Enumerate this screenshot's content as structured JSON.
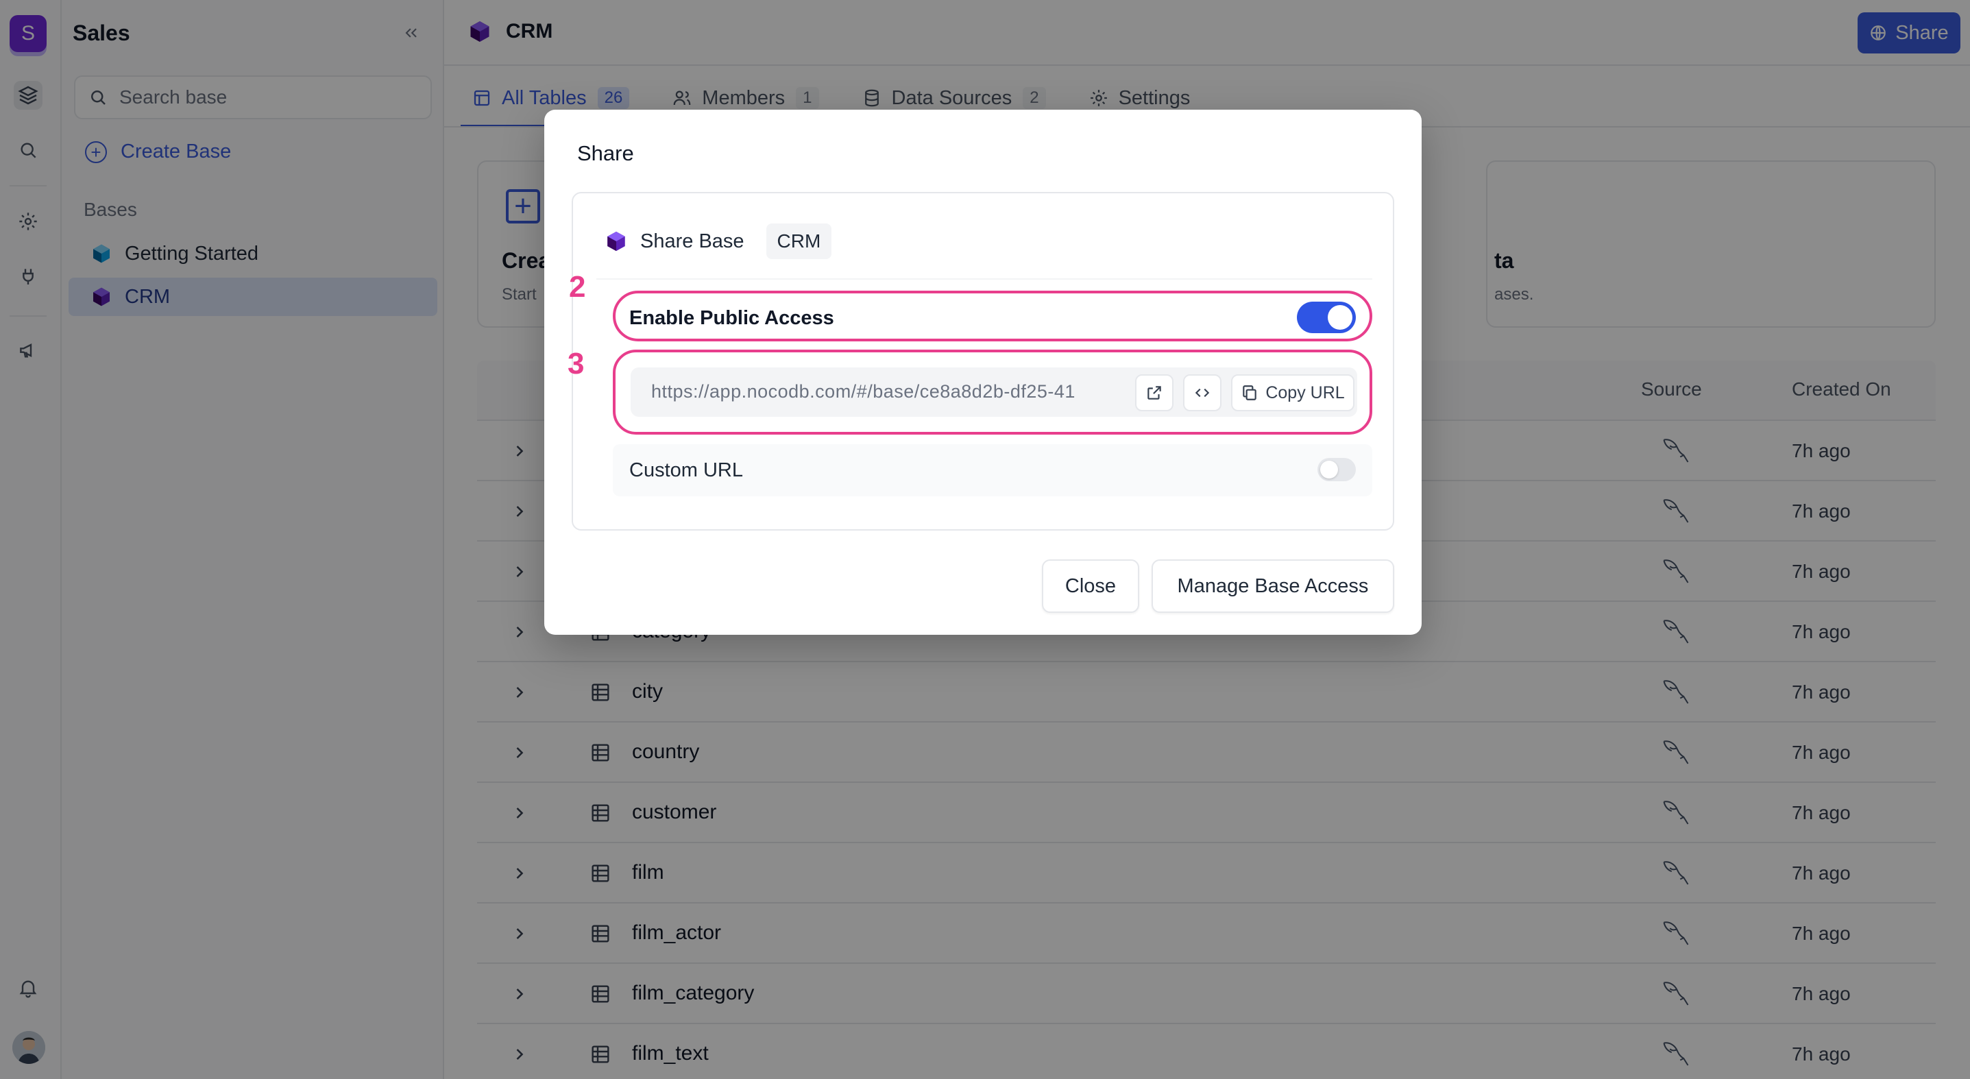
{
  "workspace": {
    "initial": "S"
  },
  "sidebar": {
    "title": "Sales",
    "search_placeholder": "Search base",
    "create_label": "Create Base",
    "section_label": "Bases",
    "bases": [
      {
        "label": "Getting Started",
        "color": "#0ea5e9"
      },
      {
        "label": "CRM",
        "color": "#5b21b6"
      }
    ]
  },
  "header": {
    "breadcrumb": "CRM",
    "share_label": "Share"
  },
  "tabs": [
    {
      "label": "All Tables",
      "count": "26"
    },
    {
      "label": "Members",
      "count": "1"
    },
    {
      "label": "Data Sources",
      "count": "2"
    },
    {
      "label": "Settings"
    }
  ],
  "cards": {
    "create_title": "Crea",
    "create_sub": "Start",
    "right_title": "ta",
    "right_sub": "ases."
  },
  "table": {
    "columns": {
      "source": "Source",
      "created": "Created On"
    },
    "rows": [
      {
        "name": "",
        "created": "7h ago"
      },
      {
        "name": "",
        "created": "7h ago"
      },
      {
        "name": "",
        "created": "7h ago"
      },
      {
        "name": "category",
        "created": "7h ago"
      },
      {
        "name": "city",
        "created": "7h ago"
      },
      {
        "name": "country",
        "created": "7h ago"
      },
      {
        "name": "customer",
        "created": "7h ago"
      },
      {
        "name": "film",
        "created": "7h ago"
      },
      {
        "name": "film_actor",
        "created": "7h ago"
      },
      {
        "name": "film_category",
        "created": "7h ago"
      },
      {
        "name": "film_text",
        "created": "7h ago"
      }
    ]
  },
  "modal": {
    "title": "Share",
    "share_base_label": "Share Base",
    "base_tag": "CRM",
    "enable_label": "Enable Public Access",
    "enable_on": true,
    "url": "https://app.nocodb.com/#/base/ce8a8d2b-df25-41",
    "copy_label": "Copy URL",
    "custom_url_label": "Custom URL",
    "custom_url_on": false,
    "close_label": "Close",
    "manage_label": "Manage Base Access",
    "step_badges": [
      "2",
      "3"
    ]
  },
  "colors": {
    "accent": "#3b5bdb",
    "annotation": "#e83e8c",
    "toggle_on": "#2f55e4"
  }
}
